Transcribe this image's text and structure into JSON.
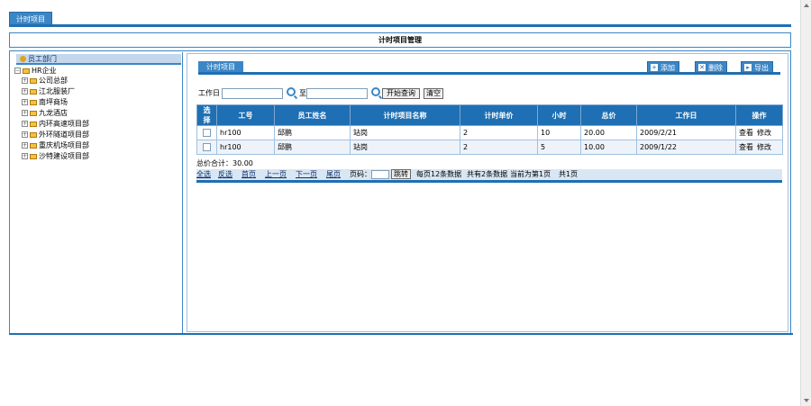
{
  "top": {
    "tab_label": "计时项目"
  },
  "title": "计时项目管理",
  "tree": {
    "header": "员工部门",
    "root": "HR企业",
    "items": [
      "公司总部",
      "江北服装厂",
      "南坪商场",
      "九龙酒店",
      "内环高速项目部",
      "外环隧道项目部",
      "重庆机场项目部",
      "沙特建设项目部"
    ]
  },
  "panel": {
    "tab_label": "计时项目",
    "add_label": "添加",
    "delete_label": "删除",
    "export_label": "导出"
  },
  "search": {
    "label_date": "工作日",
    "label_to": "至",
    "search_button": "开始查询",
    "clear_button": "清空"
  },
  "table": {
    "columns": [
      "选择",
      "工号",
      "员工姓名",
      "计时项目名称",
      "计时单价",
      "小时",
      "总价",
      "工作日",
      "操作"
    ],
    "rows": [
      {
        "id": "hr100",
        "name": "邱鹏",
        "project": "站岗",
        "price": "2",
        "hours": "10",
        "total": "20.00",
        "date": "2009/2/21",
        "view": "查看",
        "edit": "修改"
      },
      {
        "id": "hr100",
        "name": "邱鹏",
        "project": "站岗",
        "price": "2",
        "hours": "5",
        "total": "10.00",
        "date": "2009/1/22",
        "view": "查看",
        "edit": "修改"
      }
    ]
  },
  "summary": "总价合计：30.00",
  "pager": {
    "select_all": "全选",
    "invert": "反选",
    "first": "首页",
    "prev": "上一页",
    "next": "下一页",
    "last": "尾页",
    "page_label": "页码：",
    "jump": "跳转",
    "per_page": "每页12条数据",
    "total": "共有2条数据",
    "current": "当前为第1页",
    "pages": "共1页"
  }
}
